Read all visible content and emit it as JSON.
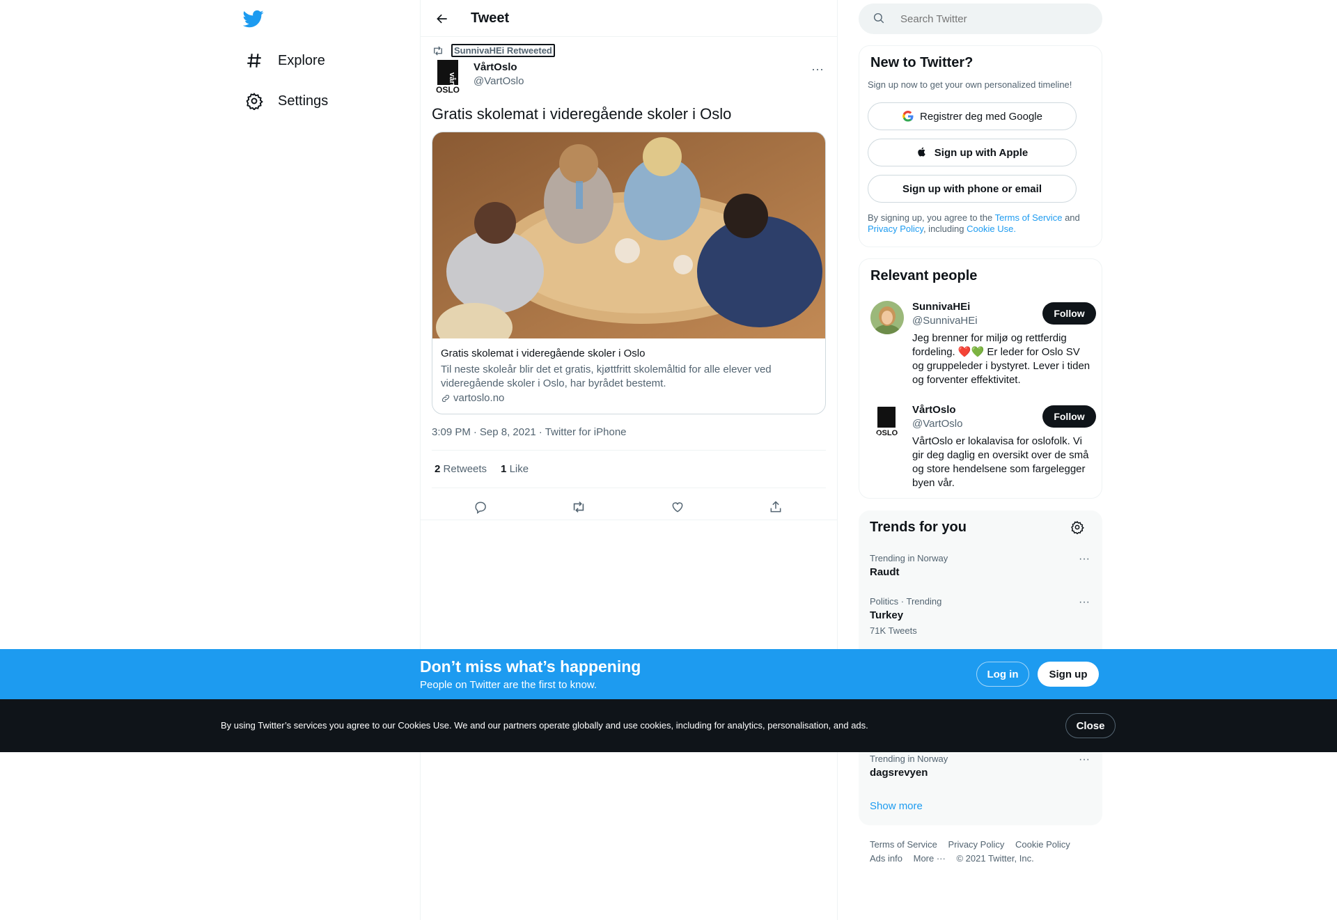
{
  "nav": {
    "items": [
      {
        "label": "Explore",
        "icon": "hashtag-icon"
      },
      {
        "label": "Settings",
        "icon": "gear-icon"
      }
    ]
  },
  "header": {
    "title": "Tweet"
  },
  "tweet": {
    "retweeted_by": "SunnivaHEi Retweeted",
    "author_name": "VårtOslo",
    "author_handle": "@VartOslo",
    "text": "Gratis skolemat i videregående skoler i Oslo",
    "card": {
      "title": "Gratis skolemat i videregående skoler i Oslo",
      "description": "Til neste skoleår blir det et gratis, kjøttfritt skolemåltid for alle elever ved videregående skoler i Oslo, har byrådet bestemt.",
      "domain": "vartoslo.no"
    },
    "time": "3:09 PM",
    "date": "Sep 8, 2021",
    "source": "Twitter for iPhone",
    "retweets_count": "2",
    "retweets_label": "Retweets",
    "likes_count": "1",
    "likes_label": "Like"
  },
  "search": {
    "placeholder": "Search Twitter"
  },
  "signup": {
    "title": "New to Twitter?",
    "subtitle": "Sign up now to get your own personalized timeline!",
    "google_label": "Registrer deg med Google",
    "apple_label": "Sign up with Apple",
    "email_label": "Sign up with phone or email",
    "terms_prefix": "By signing up, you agree to the",
    "terms_link": "Terms of Service",
    "terms_and": "and",
    "privacy_link": "Privacy Policy",
    "terms_including": ", including",
    "cookie_link": "Cookie Use."
  },
  "people": {
    "title": "Relevant people",
    "list": [
      {
        "name": "SunnivaHEi",
        "handle": "@SunnivaHEi",
        "bio": "Jeg brenner for miljø og rettferdig fordeling. ❤️💚 Er leder for Oslo SV og gruppeleder i bystyret. Lever i tiden og forventer effektivitet.",
        "follow_label": "Follow"
      },
      {
        "name": "VårtOslo",
        "handle": "@VartOslo",
        "bio": "VårtOslo er lokalavisa for oslofolk. Vi gir deg daglig en oversikt over de små og store hendelsene som fargelegger byen vår.",
        "follow_label": "Follow"
      }
    ]
  },
  "trends": {
    "title": "Trends for you",
    "items": [
      {
        "context": "Trending in Norway",
        "name": "Raudt",
        "count": ""
      },
      {
        "context": "Politics · Trending",
        "name": "Turkey",
        "count": "71K Tweets"
      },
      {
        "context": "Trending in Norway",
        "name": "dagsrevyen",
        "count": ""
      }
    ],
    "show_more": "Show more"
  },
  "footer": {
    "links": [
      "Terms of Service",
      "Privacy Policy",
      "Cookie Policy",
      "Ads info",
      "More ···",
      "© 2021 Twitter, Inc."
    ]
  },
  "bottom_bar": {
    "title": "Don’t miss what’s happening",
    "subtitle": "People on Twitter are the first to know.",
    "login_label": "Log in",
    "signup_label": "Sign up"
  },
  "cookie_bar": {
    "text": "By using Twitter’s services you agree to our Cookies Use. We and our partners operate globally and use cookies, including for analytics, personalisation, and ads.",
    "close_label": "Close"
  },
  "colors": {
    "accent": "#1d9bf0",
    "text": "#0f1419",
    "muted": "#536471",
    "dark_bar": "#0f1419"
  }
}
